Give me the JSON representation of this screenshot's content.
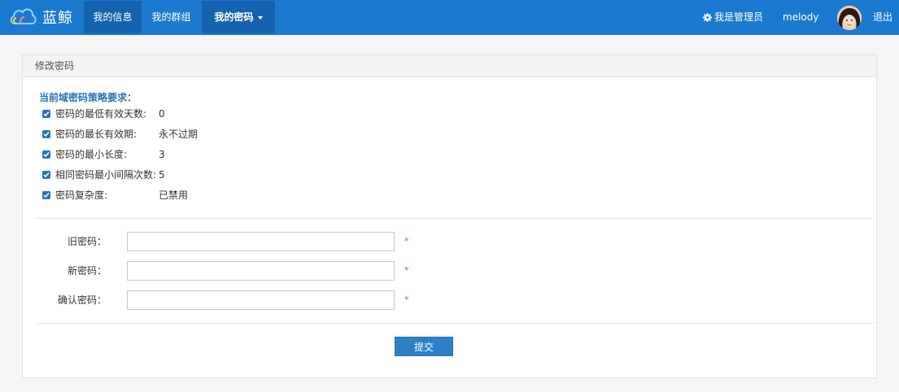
{
  "brand": {
    "name": "蓝鲸",
    "logo_icon": "cloud-logo-icon"
  },
  "nav": {
    "items": [
      {
        "label": "我的信息",
        "active": true
      },
      {
        "label": "我的群组",
        "active": false
      },
      {
        "label": "我的密码",
        "active": true,
        "dropdown": true
      }
    ],
    "admin_label": "我是管理员",
    "admin_icon": "gear-icon",
    "username": "melody",
    "logout_label": "退出"
  },
  "panel": {
    "title": "修改密码",
    "policy_title": "当前域密码策略要求：",
    "policies": [
      {
        "label": "密码的最低有效天数:",
        "value": "0"
      },
      {
        "label": "密码的最长有效期:",
        "value": "永不过期"
      },
      {
        "label": "密码的最小长度:",
        "value": "3"
      },
      {
        "label": "相同密码最小间隔次数:",
        "value": "5"
      },
      {
        "label": "密码复杂度:",
        "value": "已禁用"
      }
    ],
    "form": {
      "old_password_label": "旧密码：",
      "new_password_label": "新密码：",
      "confirm_password_label": "确认密码：",
      "required_mark": "*",
      "submit_label": "提交"
    }
  },
  "colors": {
    "nav_bg": "#1b79d0",
    "nav_active": "#1563b0",
    "accent": "#2b72b8",
    "button": "#2f7fc7",
    "required": "#d9534f"
  }
}
